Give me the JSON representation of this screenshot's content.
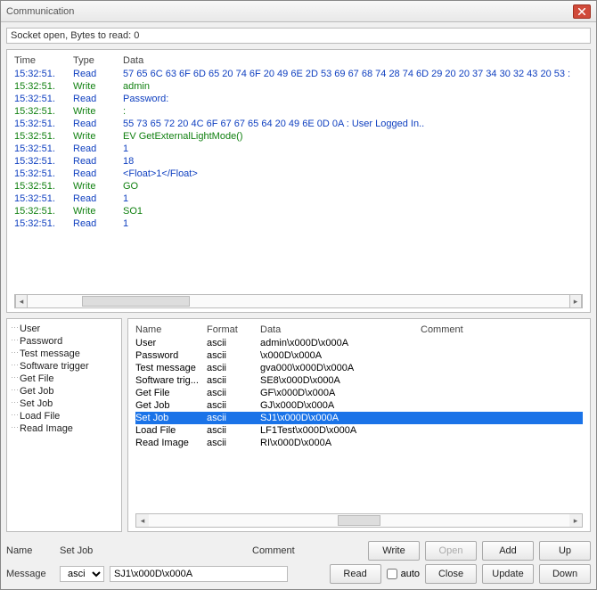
{
  "window": {
    "title": "Communication"
  },
  "status": "Socket open, Bytes to read: 0",
  "log_header": {
    "time": "Time",
    "type": "Type",
    "data": "Data"
  },
  "log": [
    {
      "time": "15:32:51.",
      "kind": "Read",
      "data": "57 65 6C 63 6F 6D 65 20 74 6F 20 49 6E 2D 53 69 67 68 74 28 74 6D 29 20 20 37 34 30 32 43 20 53 :"
    },
    {
      "time": "15:32:51.",
      "kind": "Write",
      "data": "admin"
    },
    {
      "time": "15:32:51.",
      "kind": "Read",
      "data": "Password:"
    },
    {
      "time": "15:32:51.",
      "kind": "Write",
      "data": ": "
    },
    {
      "time": "15:32:51.",
      "kind": "Read",
      "data": "55 73 65 72 20 4C 6F 67 67 65 64 20 49 6E 0D 0A : User Logged In.."
    },
    {
      "time": "15:32:51.",
      "kind": "Write",
      "data": "EV GetExternalLightMode()"
    },
    {
      "time": "15:32:51.",
      "kind": "Read",
      "data": "1"
    },
    {
      "time": "15:32:51.",
      "kind": "Read",
      "data": "18"
    },
    {
      "time": "15:32:51.",
      "kind": "Read",
      "data": "<Float>1</Float>"
    },
    {
      "time": "15:32:51.",
      "kind": "Write",
      "data": "GO"
    },
    {
      "time": "15:32:51.",
      "kind": "Read",
      "data": "1"
    },
    {
      "time": "15:32:51.",
      "kind": "Write",
      "data": "SO1"
    },
    {
      "time": "15:32:51.",
      "kind": "Read",
      "data": "1"
    }
  ],
  "tree": [
    "User",
    "Password",
    "Test message",
    "Software trigger",
    "Get File",
    "Get Job",
    "Set Job",
    "Load File",
    "Read Image"
  ],
  "table_header": {
    "name": "Name",
    "format": "Format",
    "data": "Data",
    "comment": "Comment"
  },
  "table": [
    {
      "name": "User",
      "format": "ascii",
      "data": "admin\\x000D\\x000A",
      "comment": "",
      "selected": false
    },
    {
      "name": "Password",
      "format": "ascii",
      "data": "\\x000D\\x000A",
      "comment": "",
      "selected": false
    },
    {
      "name": "Test message",
      "format": "ascii",
      "data": "gva000\\x000D\\x000A",
      "comment": "",
      "selected": false
    },
    {
      "name": "Software trig...",
      "format": "ascii",
      "data": "SE8\\x000D\\x000A",
      "comment": "",
      "selected": false
    },
    {
      "name": "Get File",
      "format": "ascii",
      "data": "GF\\x000D\\x000A",
      "comment": "",
      "selected": false
    },
    {
      "name": "Get Job",
      "format": "ascii",
      "data": "GJ\\x000D\\x000A",
      "comment": "",
      "selected": false
    },
    {
      "name": "Set Job",
      "format": "ascii",
      "data": "SJ1\\x000D\\x000A",
      "comment": "",
      "selected": true
    },
    {
      "name": "Load File",
      "format": "ascii",
      "data": "LF1Test\\x000D\\x000A",
      "comment": "",
      "selected": false
    },
    {
      "name": "Read Image",
      "format": "ascii",
      "data": "RI\\x000D\\x000A",
      "comment": "",
      "selected": false
    }
  ],
  "form": {
    "name_label": "Name",
    "name_value": "Set Job",
    "comment_label": "Comment",
    "comment_value": "",
    "message_label": "Message",
    "format_value": "ascii",
    "message_value": "SJ1\\x000D\\x000A",
    "auto_label": "auto",
    "auto_checked": false
  },
  "buttons": {
    "write": "Write",
    "open": "Open",
    "add": "Add",
    "up": "Up",
    "read": "Read",
    "close": "Close",
    "update": "Update",
    "down": "Down"
  }
}
